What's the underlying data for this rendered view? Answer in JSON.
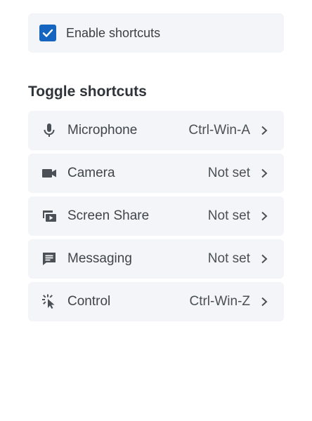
{
  "enable": {
    "label": "Enable shortcuts",
    "checked": true,
    "accent": "#1565c0"
  },
  "section": {
    "title": "Toggle shortcuts"
  },
  "shortcuts": [
    {
      "icon": "microphone-icon",
      "label": "Microphone",
      "value": "Ctrl-Win-A"
    },
    {
      "icon": "camera-icon",
      "label": "Camera",
      "value": "Not set"
    },
    {
      "icon": "screen-share-icon",
      "label": "Screen Share",
      "value": "Not set"
    },
    {
      "icon": "messaging-icon",
      "label": "Messaging",
      "value": "Not set"
    },
    {
      "icon": "control-icon",
      "label": "Control",
      "value": "Ctrl-Win-Z"
    }
  ]
}
